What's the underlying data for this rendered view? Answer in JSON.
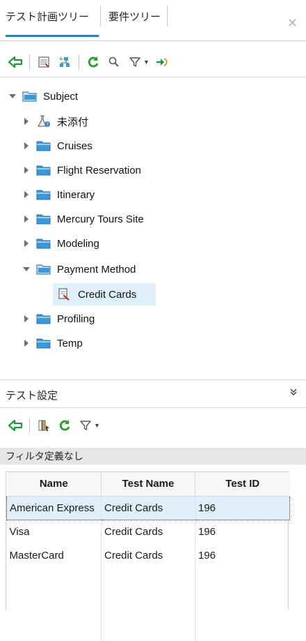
{
  "tabs": [
    {
      "label": "テスト計画ツリー",
      "active": true
    },
    {
      "label": "要件ツリー",
      "active": false
    }
  ],
  "close_icon": "close-icon",
  "tree": {
    "root": {
      "label": "Subject",
      "expanded": true
    },
    "items": [
      {
        "label": "未添付",
        "icon": "unattached-flask-icon",
        "expanded": false
      },
      {
        "label": "Cruises",
        "icon": "folder-icon",
        "expanded": false
      },
      {
        "label": "Flight Reservation",
        "icon": "folder-icon",
        "expanded": false
      },
      {
        "label": "Itinerary",
        "icon": "folder-icon",
        "expanded": false
      },
      {
        "label": "Mercury Tours Site",
        "icon": "folder-icon",
        "expanded": false
      },
      {
        "label": "Modeling",
        "icon": "folder-icon",
        "expanded": false
      },
      {
        "label": "Payment Method",
        "icon": "folder-open-icon",
        "expanded": true
      },
      {
        "label": "Credit Cards",
        "icon": "test-script-icon",
        "selected": true
      },
      {
        "label": "Profiling",
        "icon": "folder-icon",
        "expanded": false
      },
      {
        "label": "Temp",
        "icon": "folder-icon",
        "expanded": false
      }
    ]
  },
  "bottom_panel": {
    "title": "テスト設定",
    "filter_text": "フィルタ定義なし",
    "grid": {
      "columns": [
        "Name",
        "Test Name",
        "Test ID"
      ],
      "rows": [
        [
          "American Express",
          "Credit Cards",
          "196"
        ],
        [
          "Visa",
          "Credit Cards",
          "196"
        ],
        [
          "MasterCard",
          "Credit Cards",
          "196"
        ]
      ],
      "selected_row": 0
    }
  },
  "colors": {
    "accent": "#1f7fd8",
    "selection": "#dff0fb",
    "folder": "#3a9ad9",
    "refresh": "#2f9e2f"
  }
}
